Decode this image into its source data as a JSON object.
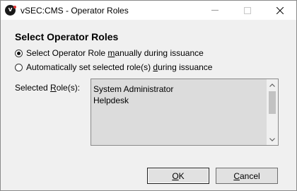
{
  "window": {
    "title": "vSEC:CMS - Operator Roles",
    "app_icon_letter": "v"
  },
  "dialog": {
    "heading": "Select Operator Roles",
    "options": [
      {
        "label_pre": "Select Operator Role ",
        "label_accel": "m",
        "label_post": "anually during issuance",
        "selected": true
      },
      {
        "label_pre": "Automatically set selected role(s) ",
        "label_accel": "d",
        "label_post": "uring issuance",
        "selected": false
      }
    ],
    "roles_label_pre": "Selected ",
    "roles_label_accel": "R",
    "roles_label_post": "ole(s):",
    "roles": [
      "System Administrator",
      "Helpdesk"
    ]
  },
  "buttons": {
    "ok_accel": "O",
    "ok_rest": "K",
    "cancel_accel": "C",
    "cancel_rest": "ancel"
  }
}
